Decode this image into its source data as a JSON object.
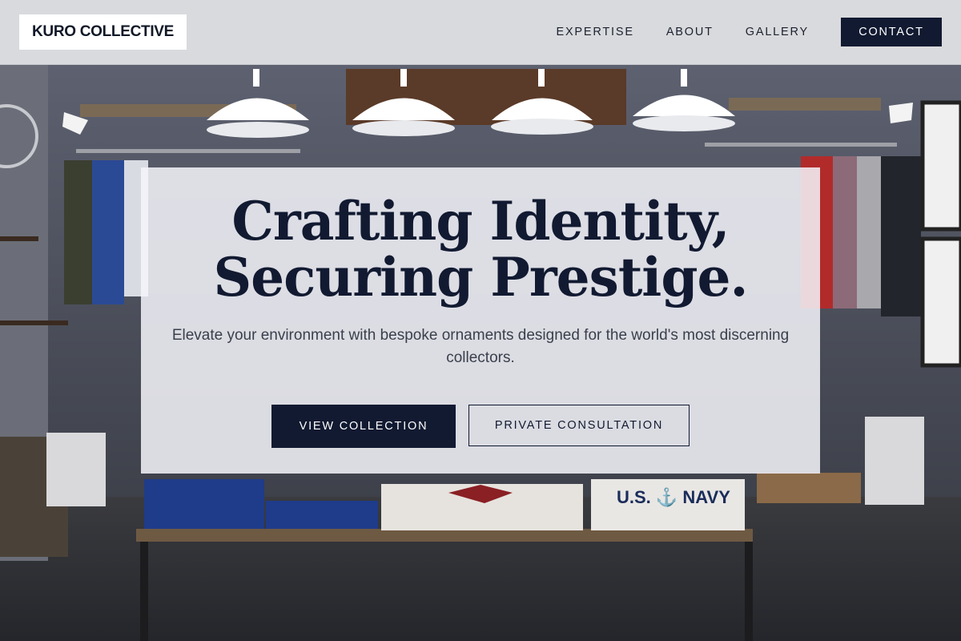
{
  "brand": {
    "logo_text": "KURO COLLECTIVE"
  },
  "nav": {
    "links": [
      "EXPERTISE",
      "ABOUT",
      "GALLERY"
    ],
    "contact_label": "CONTACT"
  },
  "hero": {
    "title_line1": "Crafting Identity,",
    "title_line2": "Securing Prestige.",
    "subtitle": "Elevate your environment with bespoke ornaments designed for the world's most discerning collectors.",
    "primary_cta": "VIEW COLLECTION",
    "secondary_cta": "PRIVATE CONSULTATION"
  },
  "background": {
    "image_name": "clothing-store-interior-photo",
    "shirt_text": "U.S. ⚓ NAVY"
  },
  "colors": {
    "navy": "#111a31",
    "header_bg": "#e9eaed",
    "panel_bg": "#f4f5fa",
    "body_text": "#3a3f4b"
  }
}
